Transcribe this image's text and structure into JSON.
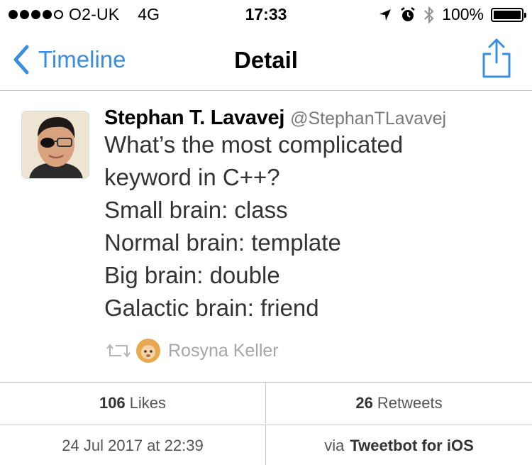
{
  "status_bar": {
    "carrier": "O2-UK",
    "network": "4G",
    "time": "17:33",
    "battery": "100%",
    "battery_level": 1.0,
    "signal_bars_filled": 4,
    "signal_bars_total": 5
  },
  "nav": {
    "back_label": "Timeline",
    "title": "Detail",
    "share_icon": "share-icon"
  },
  "tweet": {
    "author_name": "Stephan T. Lavavej",
    "author_handle": "@StephanTLavavej",
    "lines": [
      "What’s the most complicated",
      "keyword in C++?",
      "Small brain: class",
      "Normal brain: template",
      "Big brain: double",
      "Galactic brain: friend"
    ],
    "retweeted_by": "Rosyna Keller"
  },
  "stats": {
    "likes_count": "106",
    "likes_label": "Likes",
    "retweets_count": "26",
    "retweets_label": "Retweets",
    "date": "24 Jul 2017 at 22:39",
    "via_prefix": "via",
    "via_app": "Tweetbot for iOS"
  },
  "colors": {
    "accent": "#3b8ddd",
    "divider": "#c8c7cc",
    "muted": "#a6a6a6"
  }
}
